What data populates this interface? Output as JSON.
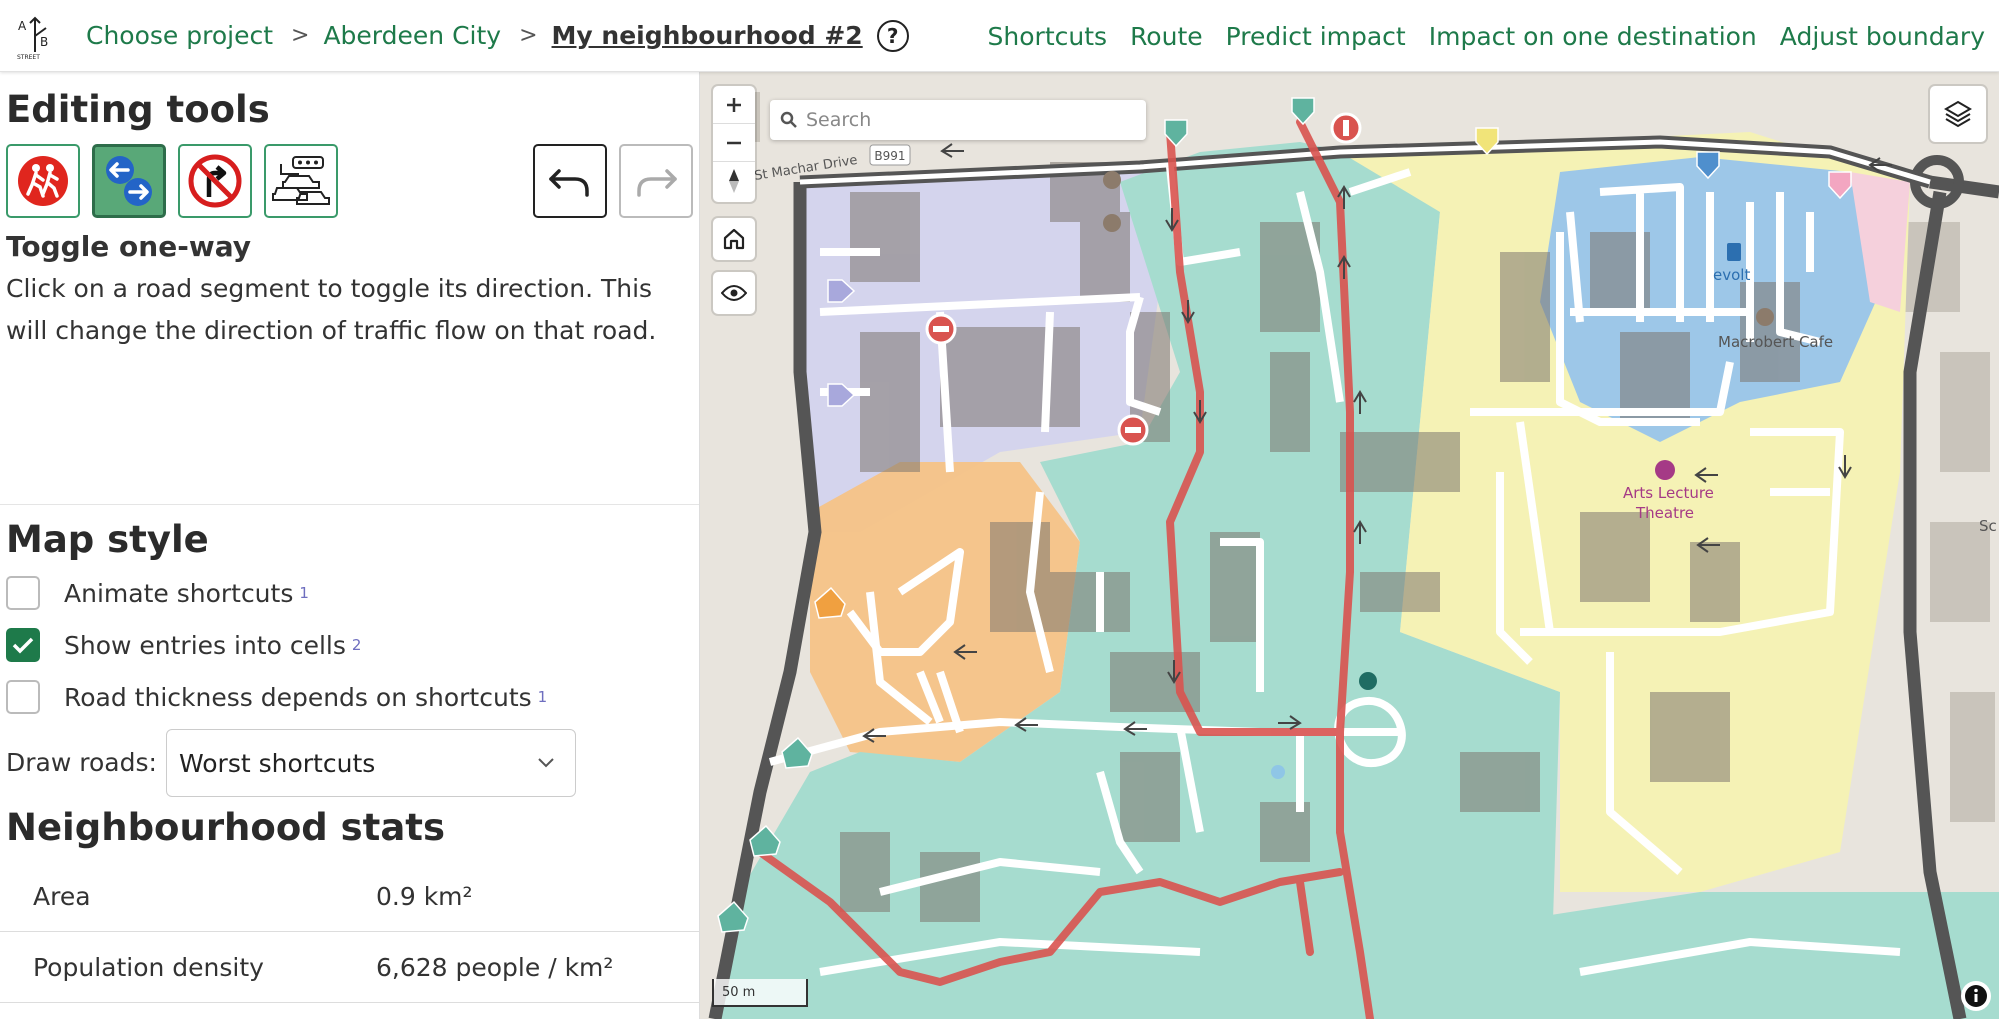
{
  "header": {
    "logo": "ab-street-logo",
    "breadcrumbs": [
      {
        "label": "Choose project"
      },
      {
        "label": "Aberdeen City"
      }
    ],
    "separator": ">",
    "current_project": "My neighbourhood #2",
    "help_glyph": "?",
    "nav": [
      "Shortcuts",
      "Route",
      "Predict impact",
      "Impact on one destination",
      "Adjust boundary"
    ]
  },
  "sidebar": {
    "editing_tools": {
      "title": "Editing tools",
      "tools": [
        {
          "name": "walking-zone-tool-icon",
          "active": false
        },
        {
          "name": "toggle-one-way-tool-icon",
          "active": true
        },
        {
          "name": "no-right-turn-tool-icon",
          "active": false
        },
        {
          "name": "main-road-tool-icon",
          "active": false
        }
      ],
      "undo_icon": "undo-icon",
      "redo_icon": "redo-icon",
      "selected_tool_name": "Toggle one-way",
      "selected_tool_description": "Click on a road segment to toggle its direction. This will change the direction of traffic flow on that road."
    },
    "map_style": {
      "title": "Map style",
      "options": [
        {
          "label": "Animate shortcuts",
          "footnote": "1",
          "checked": false
        },
        {
          "label": "Show entries into cells",
          "footnote": "2",
          "checked": true
        },
        {
          "label": "Road thickness depends on shortcuts",
          "footnote": "1",
          "checked": false
        }
      ],
      "draw_roads_label": "Draw roads:",
      "draw_roads_value": "Worst shortcuts"
    },
    "stats": {
      "title": "Neighbourhood stats",
      "rows": [
        {
          "label": "Area",
          "value": "0.9 km²"
        },
        {
          "label": "Population density",
          "value": "6,628 people / km²"
        }
      ]
    }
  },
  "map": {
    "search_placeholder": "Search",
    "scale_label": "50 m",
    "road_ref": "B991",
    "street_name": "St Machar Drive",
    "pois": [
      "evolt",
      "Macrobert Cafe",
      "Arts Lecture",
      "Theatre",
      "Sc"
    ],
    "cell_colors": {
      "teal": "#a6dccf",
      "yellow": "#f5f2b5",
      "blue": "#9dc7e8",
      "orange": "#f5c387",
      "lavender": "#d2d2ee",
      "pink": "#f5d0dc"
    },
    "shortcut_color": "#d9534f",
    "accent": "#1e7a4a"
  }
}
